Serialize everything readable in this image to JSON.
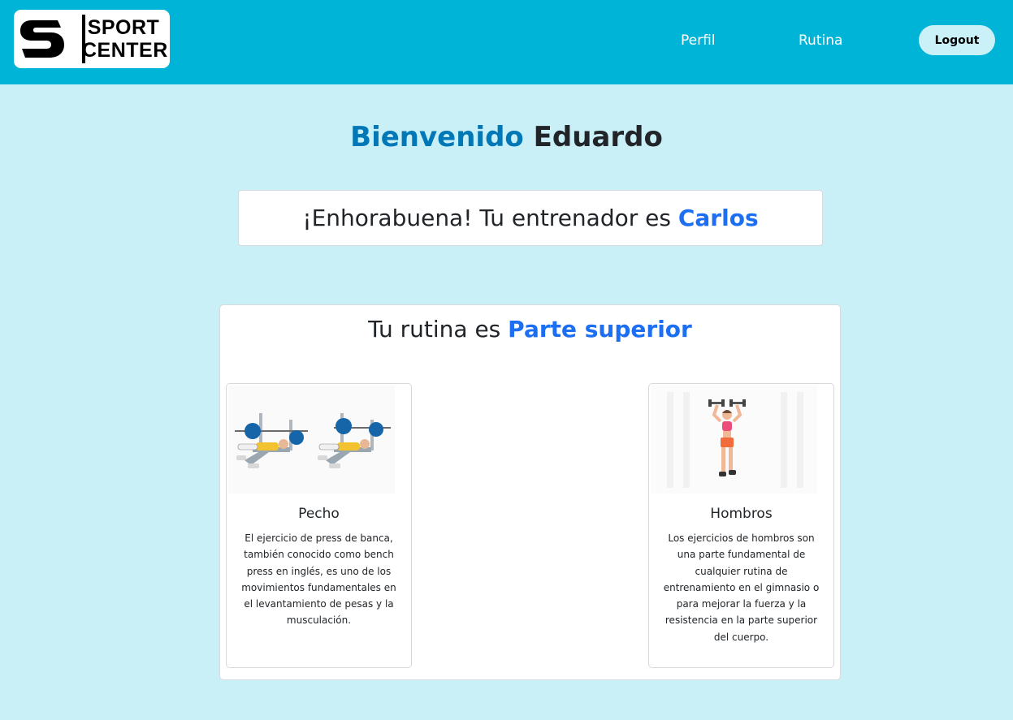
{
  "header": {
    "logo_line1": "SPORT",
    "logo_line2": "CENTER",
    "nav": {
      "perfil": "Perfil",
      "rutina": "Rutina"
    },
    "logout_label": "Logout"
  },
  "welcome": {
    "greeting": "Bienvenido",
    "name": "Eduardo"
  },
  "trainer": {
    "message": "¡Enhorabuena! Tu entrenador es",
    "name": "Carlos"
  },
  "routine": {
    "label": "Tu rutina es",
    "name": "Parte superior",
    "exercises": [
      {
        "name": "Pecho",
        "description": "El ejercicio de press de banca, también conocido como bench press en inglés, es uno de los movimientos fundamentales en el levantamiento de pesas y la musculación.",
        "image_icon": "bench-press-illustration"
      },
      {
        "name": "Hombros",
        "description": "Los ejercicios de hombros son una parte fundamental de cualquier rutina de entrenamiento en el gimnasio o para mejorar la fuerza y la resistencia en la parte superior del cuerpo.",
        "image_icon": "shoulder-press-illustration"
      }
    ]
  },
  "colors": {
    "navbar": "#00b4d8",
    "page_background": "#c9eff7",
    "accent_blue": "#1c6ef2",
    "welcome_blue": "#0077b6"
  }
}
